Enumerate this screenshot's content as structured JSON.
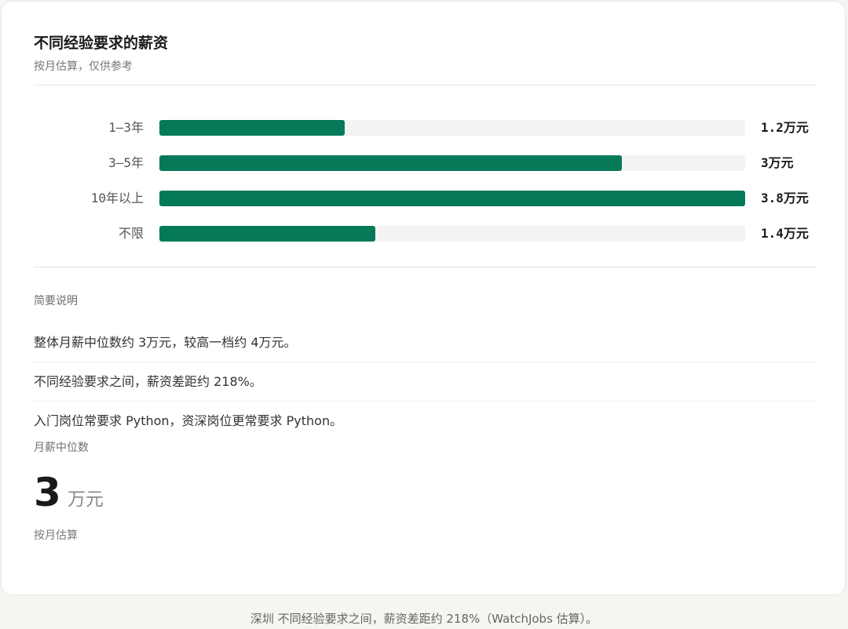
{
  "card": {
    "title": "不同经验要求的薪资",
    "subtitle": "按月估算，仅供参考"
  },
  "chart_data": {
    "type": "bar",
    "orientation": "horizontal",
    "categories": [
      "1–3年",
      "3–5年",
      "10年以上",
      "不限"
    ],
    "values": [
      1.2,
      3,
      3.8,
      1.4
    ],
    "value_labels": [
      "1.2万元",
      "3万元",
      "3.8万元",
      "1.4万元"
    ],
    "unit": "万元",
    "xlim": [
      0,
      3.8
    ],
    "bar_color": "#067a58",
    "track_color": "#f3f3f3",
    "title": "不同经验要求的薪资",
    "subtitle": "按月估算，仅供参考",
    "grid": false
  },
  "summary": {
    "label": "简要说明",
    "notes": [
      "整体月薪中位数约 3万元，较高一档约 4万元。",
      "不同经验要求之间，薪资差距约 218%。",
      "入门岗位常要求 Python，资深岗位更常要求 Python。"
    ]
  },
  "median": {
    "label": "月薪中位数",
    "value": "3",
    "unit": "万元",
    "note": "按月估算"
  },
  "caption": "深圳 不同经验要求之间，薪资差距约 218%（WatchJobs 估算）。"
}
